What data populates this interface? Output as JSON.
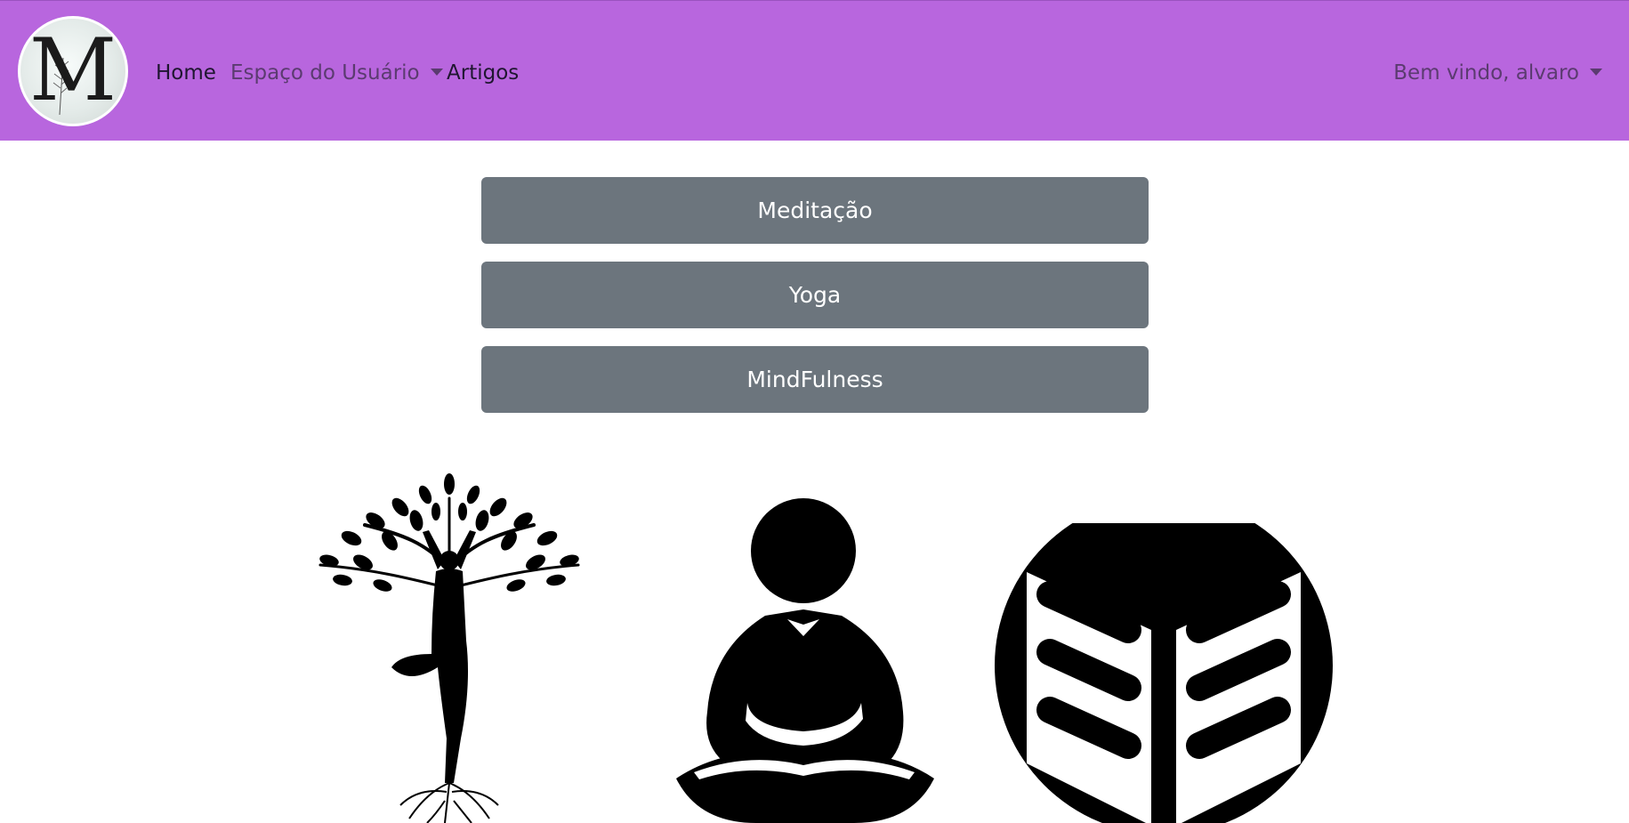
{
  "navbar": {
    "logo_letter": "M",
    "links": [
      "Home",
      "Espaço do Usuário",
      "Artigos"
    ],
    "user_menu": "Bem vindo, alvaro",
    "background": "#b866de"
  },
  "categories": {
    "buttons": [
      "Meditação",
      "Yoga",
      "MindFulness"
    ],
    "button_color": "#6c757d"
  },
  "images": {
    "icons": [
      "yoga-tree-icon",
      "meditation-person-icon",
      "book-icon"
    ]
  }
}
